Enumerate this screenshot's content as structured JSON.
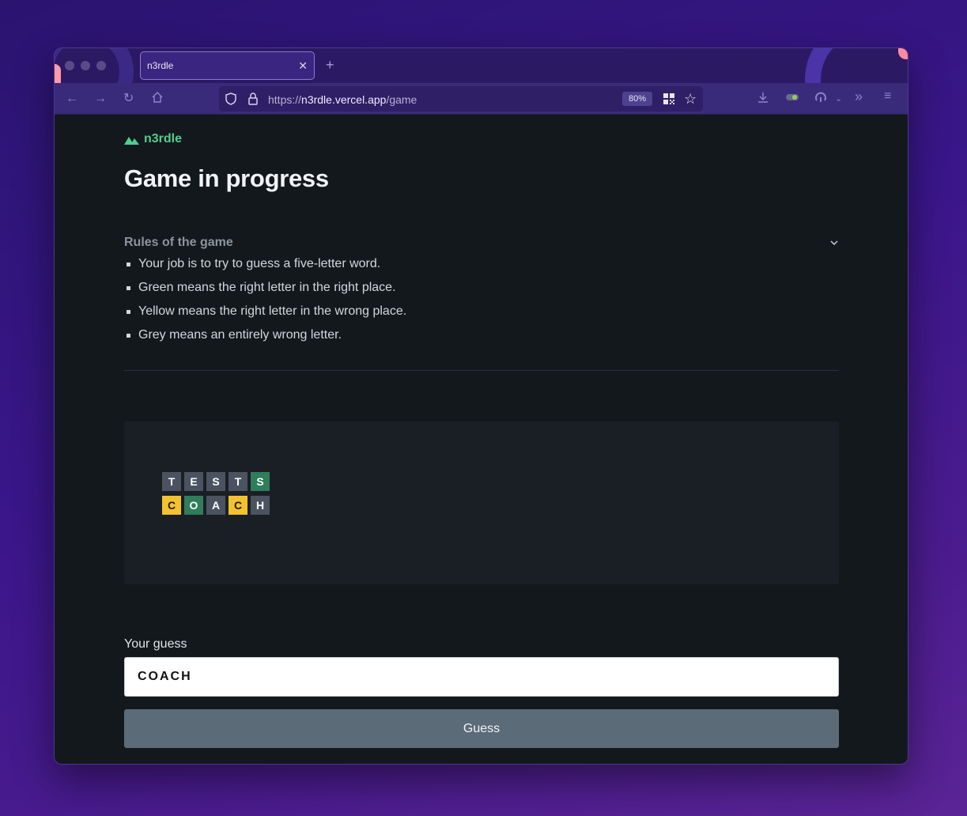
{
  "browser": {
    "tab_title": "n3rdle",
    "tab_close_icon": "close-icon",
    "new_tab_icon": "plus-icon",
    "url_prefix": "https://",
    "url_host": "n3rdle.vercel.app",
    "url_path": "/game",
    "zoom": "80%"
  },
  "app": {
    "logo_text": "n3rdle",
    "logo_color": "#4fce8e",
    "page_title": "Game in progress"
  },
  "rules": {
    "title": "Rules of the game",
    "items": [
      "Your job is to try to guess a five-letter word.",
      "Green means the right letter in the right place.",
      "Yellow means the right letter in the wrong place.",
      "Grey means an entirely wrong letter."
    ]
  },
  "board": {
    "rows": [
      [
        {
          "letter": "T",
          "status": "grey"
        },
        {
          "letter": "E",
          "status": "grey"
        },
        {
          "letter": "S",
          "status": "grey"
        },
        {
          "letter": "T",
          "status": "grey"
        },
        {
          "letter": "S",
          "status": "green"
        }
      ],
      [
        {
          "letter": "C",
          "status": "yellow"
        },
        {
          "letter": "O",
          "status": "green"
        },
        {
          "letter": "A",
          "status": "grey"
        },
        {
          "letter": "C",
          "status": "yellow"
        },
        {
          "letter": "H",
          "status": "grey"
        }
      ]
    ],
    "colors": {
      "green": "#2f7d5a",
      "yellow": "#f4c22e",
      "grey": "#4b5361"
    }
  },
  "guess": {
    "label": "Your guess",
    "value": "COACH",
    "button_label": "Guess"
  }
}
